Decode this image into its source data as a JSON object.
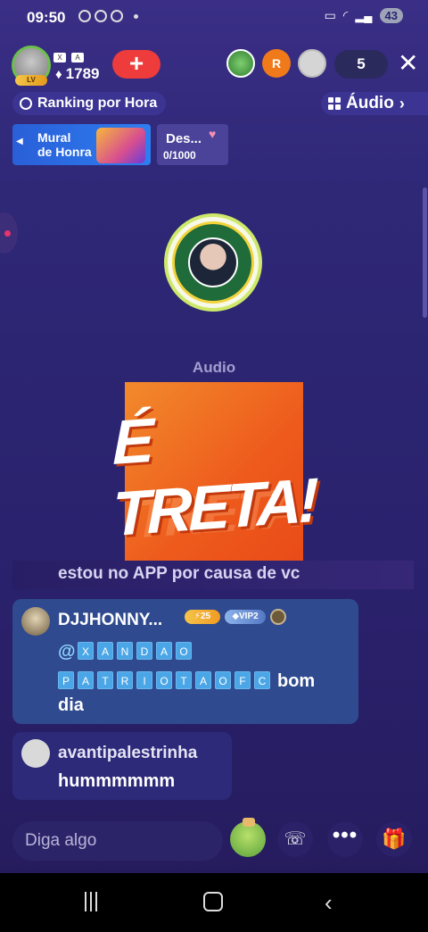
{
  "status_bar": {
    "time": "09:50",
    "battery": "43"
  },
  "header": {
    "host_score": "1789",
    "host_tags": [
      "X",
      "A"
    ],
    "host_level": "LV",
    "add_label": "+",
    "viewer_initial": "R",
    "viewer_count": "5",
    "close_label": "✕"
  },
  "ranking": {
    "label": "Ranking por Hora"
  },
  "audio_menu": {
    "label": "Áudio",
    "chevron": "›"
  },
  "mural": {
    "line1": "Mural",
    "line2": "de Honra"
  },
  "des_card": {
    "title": "Des...",
    "count": "0/1000"
  },
  "seat": {
    "label": "Audio"
  },
  "media": {
    "title": "É TRETA!",
    "caption": "estou no APP por causa de vc"
  },
  "chat": [
    {
      "name": "DJJHONNY...",
      "level_badge": "⚡25",
      "vip_badge": "◆VIP2",
      "mention_prefix": "@",
      "mention_row1": [
        "X",
        "A",
        "N",
        "D",
        "A",
        "O"
      ],
      "mention_row2": [
        "P",
        "A",
        "T",
        "R",
        "I",
        "O",
        "T",
        "A",
        "O",
        "F",
        "C"
      ],
      "text_tail": "bom",
      "text_tail2": "dia"
    },
    {
      "name": "avantipalestrinha",
      "text": "hummmmmm"
    }
  ],
  "input": {
    "placeholder": "Diga algo"
  },
  "icons": {
    "call": "☏",
    "more": "•••",
    "gift": "🎁"
  },
  "colors": {
    "accent_red": "#ee3b3b",
    "chat_blue": "#2f4a8e",
    "mention_box": "#4aa6e6"
  }
}
